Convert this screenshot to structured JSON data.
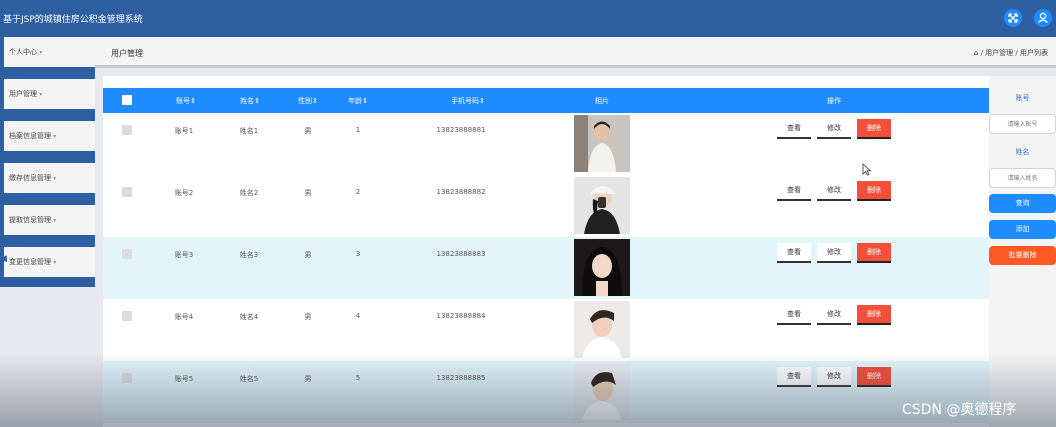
{
  "app": {
    "title": "基于JSP的城镇住房公积金管理系统"
  },
  "topbar": {
    "fullscreen_icon": "fullscreen-icon",
    "user_icon": "user-icon",
    "accent": "#1e8cff",
    "background": "#2e5fa3"
  },
  "sidebar": {
    "items": [
      {
        "label": "个人中心"
      },
      {
        "label": "用户管理"
      },
      {
        "label": "档案信息管理"
      },
      {
        "label": "缴存信息管理"
      },
      {
        "label": "提取信息管理"
      },
      {
        "label": "变更信息管理"
      }
    ]
  },
  "page": {
    "title": "用户管理",
    "breadcrumb": "/ 用户管理 / 用户列表"
  },
  "table": {
    "columns": {
      "account": "账号",
      "name": "姓名",
      "gender": "性别",
      "age": "年龄",
      "phone": "手机号码",
      "photo": "相片",
      "actions": "操作"
    },
    "rows": [
      {
        "account": "账号1",
        "name": "姓名1",
        "gender": "男",
        "age": "1",
        "phone": "13823888881"
      },
      {
        "account": "账号2",
        "name": "姓名2",
        "gender": "男",
        "age": "2",
        "phone": "13823888882"
      },
      {
        "account": "账号3",
        "name": "姓名3",
        "gender": "男",
        "age": "3",
        "phone": "13823888883"
      },
      {
        "account": "账号4",
        "name": "姓名4",
        "gender": "男",
        "age": "4",
        "phone": "13823888884"
      },
      {
        "account": "账号5",
        "name": "姓名5",
        "gender": "男",
        "age": "5",
        "phone": "13823888885"
      }
    ],
    "actions": {
      "view": "查看",
      "edit": "修改",
      "delete": "删除"
    },
    "header_color": "#1e8cff",
    "delete_color": "#f34f3a"
  },
  "search": {
    "account_label": "账号",
    "account_placeholder": "请输入账号",
    "name_label": "姓名",
    "name_placeholder": "请输入姓名",
    "query_label": "查询",
    "add_label": "添加",
    "batch_delete_label": "批量删除",
    "batch_delete_color": "#ff5a26"
  },
  "watermark": "CSDN @奥德程序"
}
